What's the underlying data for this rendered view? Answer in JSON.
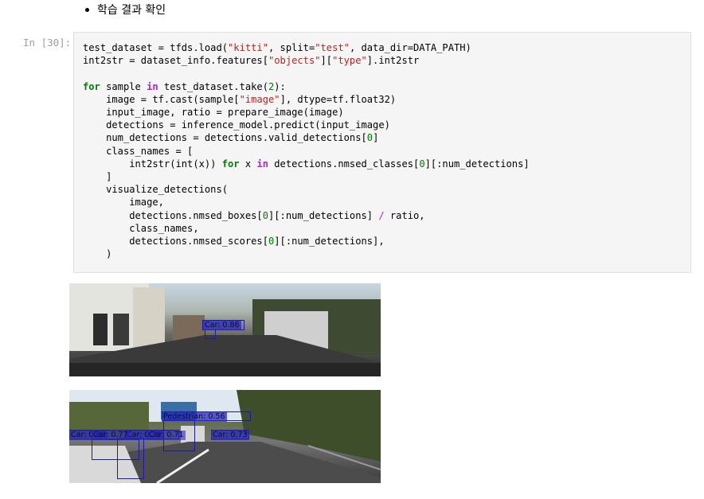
{
  "header": {
    "bullet_text": "학습 결과 확인"
  },
  "cell": {
    "prompt": "In [30]:"
  },
  "code": {
    "line1_a": "test_dataset = tfds.load(",
    "line1_s1": "\"kitti\"",
    "line1_b": ", split=",
    "line1_s2": "\"test\"",
    "line1_c": ", data_dir=DATA_PATH)",
    "line2_a": "int2str = dataset_info.features[",
    "line2_s1": "\"objects\"",
    "line2_b": "][",
    "line2_s2": "\"type\"",
    "line2_c": "].int2str",
    "line3_kw1": "for",
    "line3_a": " sample ",
    "line3_kw2": "in",
    "line3_b": " test_dataset.take(",
    "line3_n": "2",
    "line3_c": "):",
    "line4_a": "    image = tf.cast(sample[",
    "line4_s": "\"image\"",
    "line4_b": "], dtype=tf.float32)",
    "line5": "    input_image, ratio = prepare_image(image)",
    "line6": "    detections = inference_model.predict(input_image)",
    "line7_a": "    num_detections = detections.valid_detections[",
    "line7_n": "0",
    "line7_b": "]",
    "line8": "    class_names = [",
    "line9_a": "        int2str(int(x)) ",
    "line9_kw1": "for",
    "line9_b": " x ",
    "line9_kw2": "in",
    "line9_c": " detections.nmsed_classes[",
    "line9_n": "0",
    "line9_d": "][:num_detections]",
    "line10": "    ]",
    "line11": "    visualize_detections(",
    "line12": "        image,",
    "line13_a": "        detections.nmsed_boxes[",
    "line13_n": "0",
    "line13_b": "][:num_detections] ",
    "line13_op": "/",
    "line13_c": " ratio,",
    "line14": "        class_names,",
    "line15_a": "        detections.nmsed_scores[",
    "line15_n": "0",
    "line15_b": "][:num_detections],",
    "line16": "    )"
  },
  "output1": {
    "labels": [
      "Car: 0.86"
    ]
  },
  "output2": {
    "labels": [
      "Pedestrian: 0.56",
      "Car: 0.69",
      "Car: 0.71",
      "Car: 0.77",
      "Car: 0.71",
      "Car: 0.73"
    ]
  }
}
